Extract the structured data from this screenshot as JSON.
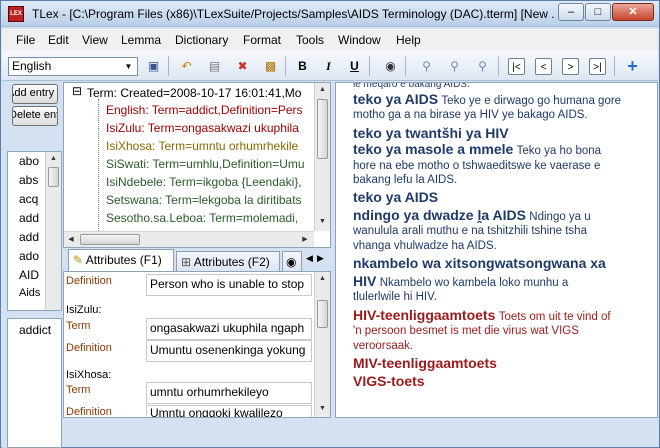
{
  "window": {
    "title": "TLex - [C:\\Program Files (x86)\\TLexSuite/Projects/Samples\\AIDS Terminology (DAC).tterm] [New ...",
    "controls": {
      "minimize": "–",
      "maximize": "□",
      "close": "✕"
    },
    "icon_text": "LEX"
  },
  "menu": [
    "File",
    "Edit",
    "View",
    "Lemma",
    "Dictionary",
    "Format",
    "Tools",
    "Window",
    "Help"
  ],
  "toolbar": {
    "language": "English",
    "bold": "B",
    "italic": "I",
    "underline": "U"
  },
  "left": {
    "btn_entry": "Add entry (...)",
    "btn_delete": "Delete entry",
    "words": [
      "abo",
      "abs",
      "acq",
      "add",
      "add",
      "ado",
      "AID",
      "Aids"
    ],
    "selected_word": "addict"
  },
  "tree": {
    "root": "Term:  Created=2008-10-17 16:01:41,Mo",
    "items": [
      {
        "text": "English:  Term=addict,Definition=Pers",
        "color": "#a00000"
      },
      {
        "text": "IsiZulu:  Term=ongasakwazi ukuphila",
        "color": "#a00000"
      },
      {
        "text": "IsiXhosa:  Term=umntu orhumrhekile",
        "color": "#8a6a00"
      },
      {
        "text": "SiSwati:  Term=umhlu,Definition=Umu",
        "color": "#2a5a2a"
      },
      {
        "text": "IsiNdebele:  Term=ikgoba {Leendaki},",
        "color": "#2a5a2a"
      },
      {
        "text": "Setswana:  Term=lekgoba la diritibats",
        "color": "#2a5a2a"
      },
      {
        "text": "Sesotho.sa.Leboa:  Term=molemadi,",
        "color": "#2a5a2a"
      }
    ]
  },
  "tabs": [
    "Attributes (F1)",
    "Attributes (F2)"
  ],
  "attributes": {
    "row1": {
      "label": "Definition",
      "value": "Person who is unable to stop"
    },
    "zulu_header": "IsiZulu:",
    "row2": {
      "label": "Term",
      "value": "ongasakwazi ukuphila ngaph"
    },
    "row3": {
      "label": "Definition",
      "value": "Umuntu osenenkinga yokung"
    },
    "xhosa_header": "IsiXhosa:",
    "row4": {
      "label": "Term",
      "value": "umntu orhumrhekileyo"
    },
    "row5": {
      "label": "Definition",
      "value": "Umntu ongqoki kwalilezo"
    }
  },
  "preview": {
    "line0": "le meqaro e bakang AIDS.",
    "e1_term": "teko ya AIDS",
    "e1_def_a": "Teko ye e dirwago go humana gore",
    "e1_def_b": "motho ga a na birase ya HIV ye bakago AIDS.",
    "e2_term": "teko ya twantšhi ya HIV",
    "e3_term": "teko ya masole a mmele",
    "e3_def_a": "Teko ya ho bona",
    "e3_def_b": "hore na ebe motho o tshwaeditswe ke vaerase e",
    "e3_def_c": "bakang lefu la AIDS.",
    "e4_term": "teko ya AIDS",
    "e5_term": "ndingo ya dwadze ḽa AIDS",
    "e5_def_a": "Ndingo ya u",
    "e5_def_b": "wanulula arali muthu e na tshitzhili tshine tsha",
    "e5_def_c": "vhanga vhulwadze ha AIDS.",
    "e6_term": "nkambelo wa xitsongwatsongwana xa",
    "e6_term_b": "HIV",
    "e6_def_a": "Nkambelo wo kambela loko munhu a",
    "e6_def_b": "tlulerlwile hi HIV.",
    "e7_term": "HIV-teenliggaamtoets",
    "e7_def_a": "Toets om uit te vind of",
    "e7_def_b": "'n persoon besmet is met die virus wat VIGS",
    "e7_def_c": "veroorsaak.",
    "e8_term": "MIV-teenliggaamtoets",
    "e9_term": "VIGS-toets"
  }
}
